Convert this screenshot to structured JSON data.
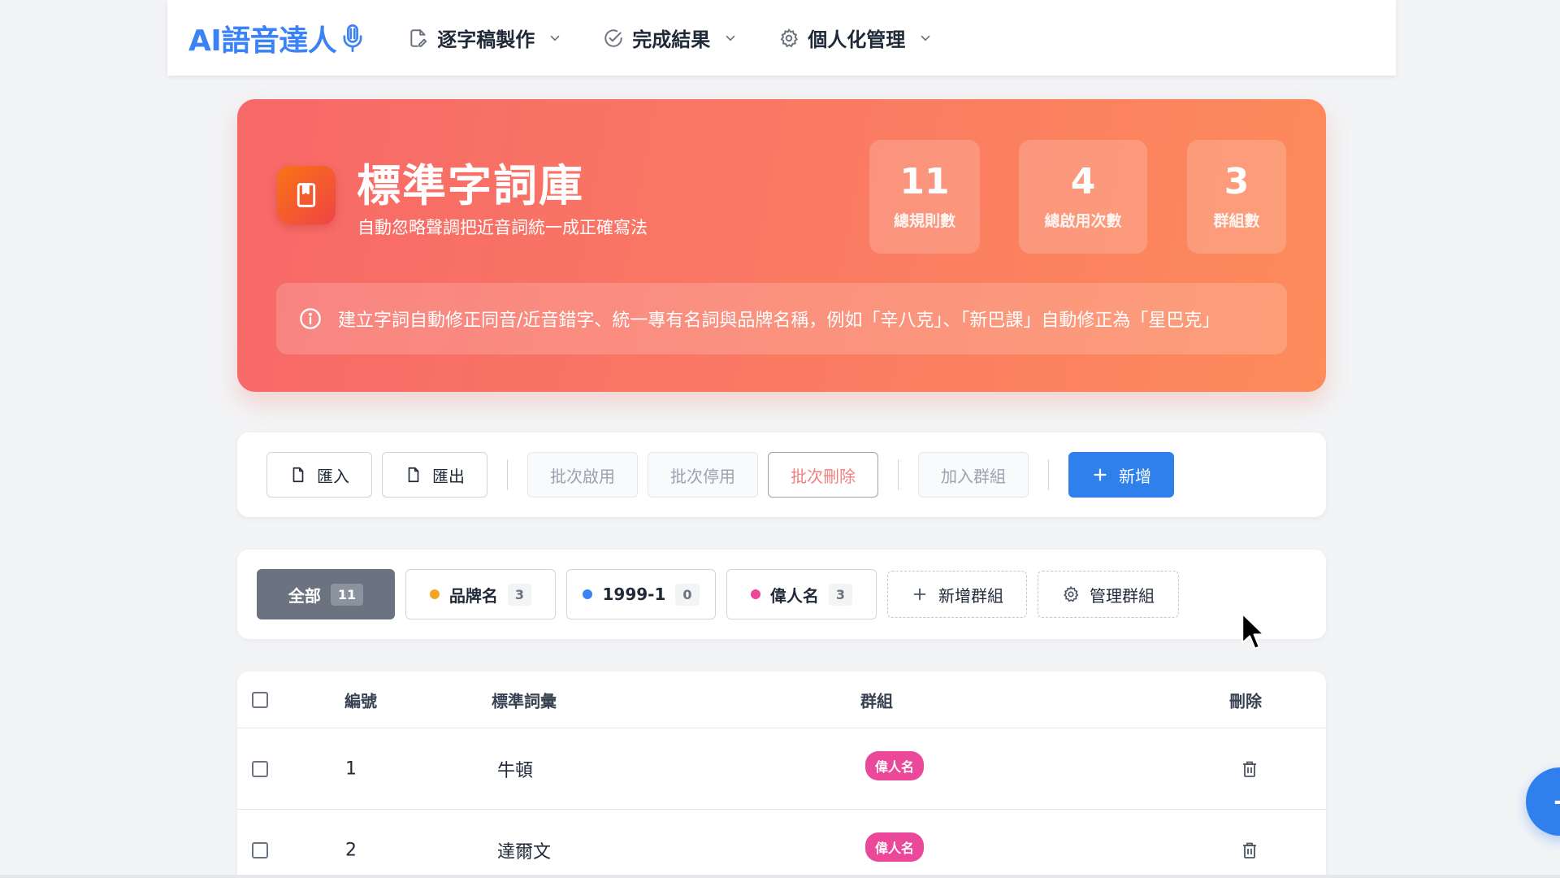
{
  "nav": {
    "brand": "AI語音達人",
    "menu": [
      {
        "label": "逐字稿製作",
        "icon": "edit-file-icon"
      },
      {
        "label": "完成結果",
        "icon": "check-circle-icon"
      },
      {
        "label": "個人化管理",
        "icon": "gear-icon"
      }
    ]
  },
  "hero": {
    "title": "標準字詞庫",
    "subtitle": "自動忽略聲調把近音詞統一成正確寫法",
    "stats": [
      {
        "value": "11",
        "label": "總規則數"
      },
      {
        "value": "4",
        "label": "總啟用次數"
      },
      {
        "value": "3",
        "label": "群組數"
      }
    ],
    "info": "建立字詞自動修正同音/近音錯字、統一專有名詞與品牌名稱，例如「辛八克」、「新巴課」自動修正為「星巴克」"
  },
  "toolbar": {
    "import_label": "匯入",
    "export_label": "匯出",
    "batch_enable_label": "批次啟用",
    "batch_disable_label": "批次停用",
    "batch_delete_label": "批次刪除",
    "add_to_group_label": "加入群組",
    "add_label": "新增"
  },
  "groups": {
    "all": {
      "label": "全部",
      "count": "11"
    },
    "items": [
      {
        "label": "品牌名",
        "count": "3",
        "color": "#f5a524"
      },
      {
        "label": "1999-1",
        "count": "0",
        "color": "#3b82f6"
      },
      {
        "label": "偉人名",
        "count": "3",
        "color": "#ec4899"
      }
    ],
    "add_group_label": "新增群組",
    "manage_group_label": "管理群組"
  },
  "table": {
    "headers": {
      "number": "編號",
      "term": "標準詞彙",
      "group": "群組",
      "delete": "刪除"
    },
    "rows": [
      {
        "number": "1",
        "term": "牛頓",
        "group": "偉人名"
      },
      {
        "number": "2",
        "term": "達爾文",
        "group": "偉人名"
      }
    ]
  },
  "colors": {
    "brand": "#3b82f6",
    "primary": "#2f80ed",
    "hero_start": "#f76868",
    "hero_end": "#fd8b5b",
    "tag": "#ec4899"
  }
}
